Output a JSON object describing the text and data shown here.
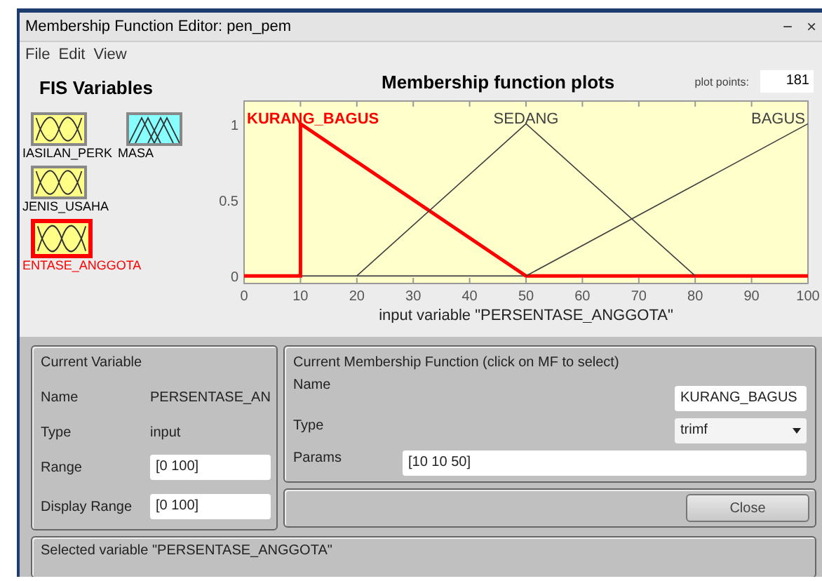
{
  "window": {
    "title": "Membership Function Editor: pen_pem",
    "controls": [
      "−",
      "×"
    ]
  },
  "menu": [
    "File",
    "Edit",
    "View"
  ],
  "fis_variables": {
    "title": "FIS Variables",
    "items": [
      {
        "label": "IASILAN_PERK",
        "kind": "input",
        "selected": false
      },
      {
        "label": "MASA",
        "kind": "output",
        "selected": false
      },
      {
        "label": "JENIS_USAHA",
        "kind": "input",
        "selected": false
      },
      {
        "label": "ENTASE_ANGGOTA",
        "kind": "input",
        "selected": true
      }
    ]
  },
  "plot": {
    "title": "Membership function plots",
    "plot_points_label": "plot points:",
    "plot_points": "181",
    "chart_data": {
      "type": "line",
      "xlabel": "input variable \"PERSENTASE_ANGGOTA\"",
      "x": [
        0,
        10,
        10,
        20,
        50,
        80,
        100
      ],
      "xlim": [
        0,
        100
      ],
      "ylim": [
        -0.05,
        1.15
      ],
      "xticks": [
        0,
        10,
        20,
        30,
        40,
        50,
        60,
        70,
        80,
        90,
        100
      ],
      "yticks": [
        0,
        0.5,
        1
      ],
      "series": [
        {
          "name": "KURANG_BAGUS",
          "color": "#ff0000",
          "values": [
            0,
            0,
            1,
            0.75,
            0,
            0,
            0
          ]
        },
        {
          "name": "SEDANG",
          "color": "#404040",
          "values": [
            null,
            null,
            null,
            0,
            1,
            0,
            null
          ]
        },
        {
          "name": "BAGUS",
          "color": "#404040",
          "values": [
            null,
            null,
            null,
            null,
            0,
            0.6,
            1
          ]
        }
      ]
    }
  },
  "current_variable": {
    "title": "Current Variable",
    "name_label": "Name",
    "name": "PERSENTASE_AN",
    "type_label": "Type",
    "type": "input",
    "range_label": "Range",
    "range": "[0 100]",
    "display_range_label": "Display Range",
    "display_range": "[0 100]"
  },
  "current_mf": {
    "title": "Current Membership Function (click on MF to select)",
    "name_label": "Name",
    "name": "KURANG_BAGUS",
    "type_label": "Type",
    "type": "trimf",
    "params_label": "Params",
    "params": "[10 10 50]"
  },
  "close_button": "Close",
  "status": "Selected variable \"PERSENTASE_ANGGOTA\""
}
